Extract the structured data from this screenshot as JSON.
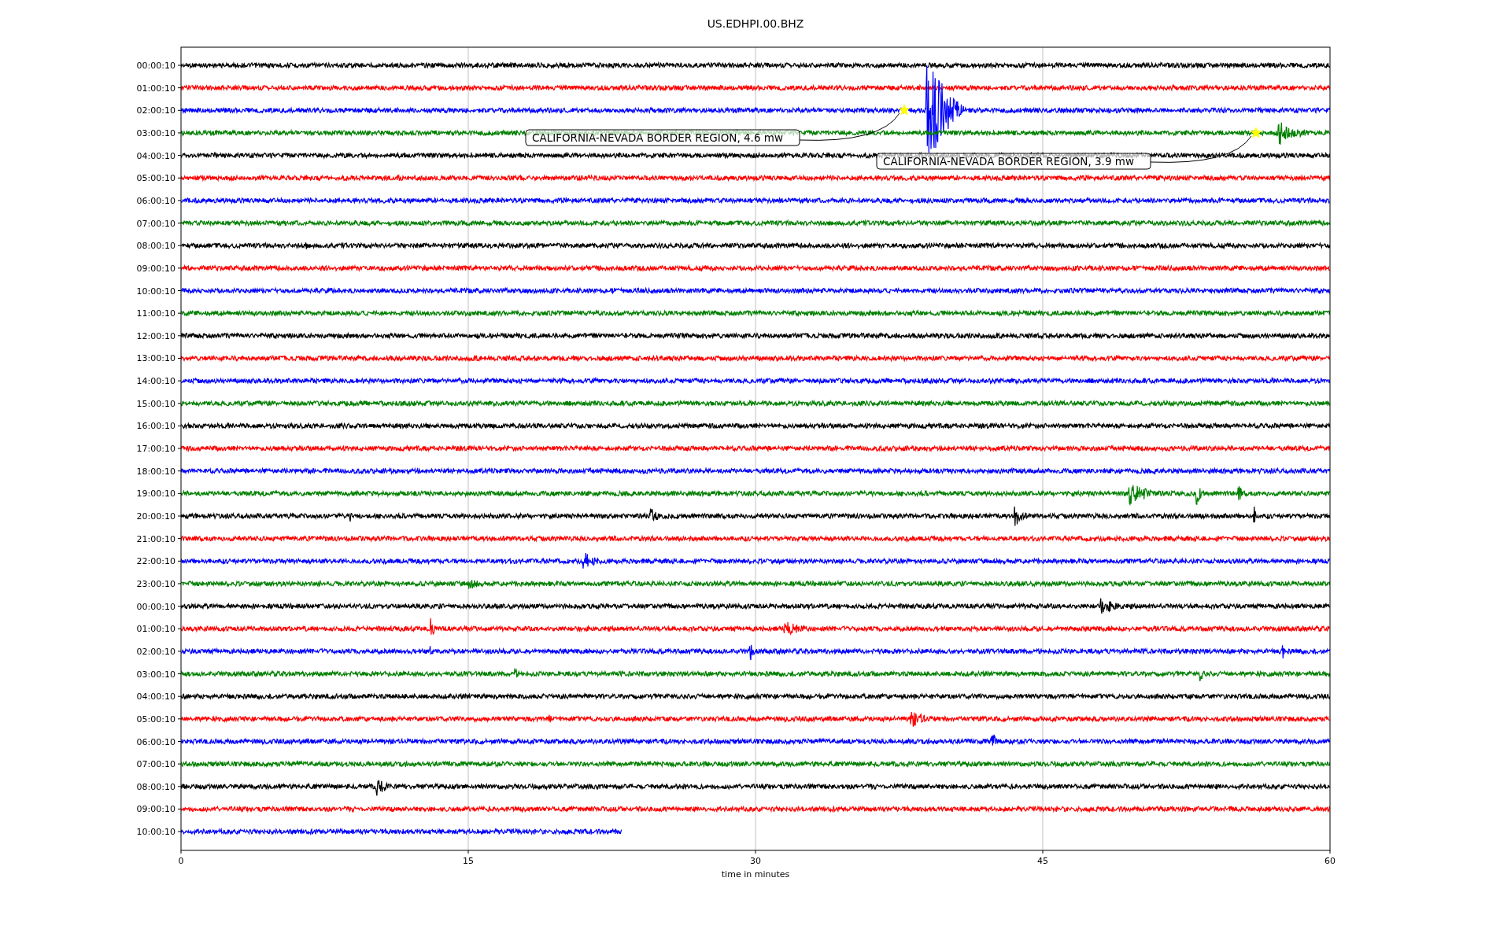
{
  "title": "US.EDHPI.00.BHZ",
  "traces": [
    {
      "label": "00:00:10",
      "color": "#000000"
    },
    {
      "label": "01:00:10",
      "color": "#ff0000"
    },
    {
      "label": "02:00:10",
      "color": "#0000ff"
    },
    {
      "label": "03:00:10",
      "color": "#008000"
    },
    {
      "label": "04:00:10",
      "color": "#000000"
    },
    {
      "label": "05:00:10",
      "color": "#ff0000"
    },
    {
      "label": "06:00:10",
      "color": "#0000ff"
    },
    {
      "label": "07:00:10",
      "color": "#008000"
    },
    {
      "label": "08:00:10",
      "color": "#000000"
    },
    {
      "label": "09:00:10",
      "color": "#ff0000"
    },
    {
      "label": "10:00:10",
      "color": "#0000ff"
    },
    {
      "label": "11:00:10",
      "color": "#008000"
    },
    {
      "label": "12:00:10",
      "color": "#000000"
    },
    {
      "label": "13:00:10",
      "color": "#ff0000"
    },
    {
      "label": "14:00:10",
      "color": "#0000ff"
    },
    {
      "label": "15:00:10",
      "color": "#008000"
    },
    {
      "label": "16:00:10",
      "color": "#000000"
    },
    {
      "label": "17:00:10",
      "color": "#ff0000"
    },
    {
      "label": "18:00:10",
      "color": "#0000ff"
    },
    {
      "label": "19:00:10",
      "color": "#008000"
    },
    {
      "label": "20:00:10",
      "color": "#000000"
    },
    {
      "label": "21:00:10",
      "color": "#ff0000"
    },
    {
      "label": "22:00:10",
      "color": "#0000ff"
    },
    {
      "label": "23:00:10",
      "color": "#008000"
    },
    {
      "label": "00:00:10",
      "color": "#000000"
    },
    {
      "label": "01:00:10",
      "color": "#ff0000"
    },
    {
      "label": "02:00:10",
      "color": "#0000ff"
    },
    {
      "label": "03:00:10",
      "color": "#008000"
    },
    {
      "label": "04:00:10",
      "color": "#000000"
    },
    {
      "label": "05:00:10",
      "color": "#ff0000"
    },
    {
      "label": "06:00:10",
      "color": "#0000ff"
    },
    {
      "label": "07:00:10",
      "color": "#008000"
    },
    {
      "label": "08:00:10",
      "color": "#000000"
    },
    {
      "label": "09:00:10",
      "color": "#ff0000"
    },
    {
      "label": "10:00:10",
      "color": "#0000ff"
    }
  ],
  "x_axis": {
    "ticks": [
      "0",
      "15",
      "30",
      "45",
      "60"
    ],
    "label": "time in minutes"
  },
  "annotations": [
    {
      "text": "CALIFORNIA-NEVADA BORDER REGION, 4.6 mw"
    },
    {
      "text": "CALIFORNIA-NEVADA BORDER REGION, 3.9 mw"
    }
  ]
}
